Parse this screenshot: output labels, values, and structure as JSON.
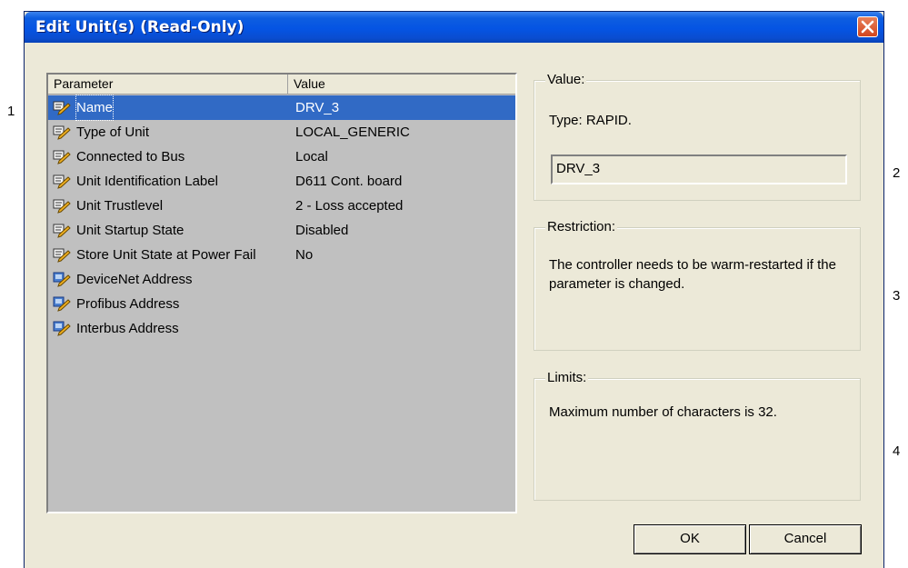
{
  "callouts": [
    "1",
    "2",
    "3",
    "4"
  ],
  "dialog": {
    "title": "Edit Unit(s) (Read-Only)"
  },
  "list": {
    "columns": [
      "Parameter",
      "Value"
    ],
    "rows": [
      {
        "icon": "edit-parameter-icon",
        "parameter": "Name",
        "value": "DRV_3",
        "selected": true
      },
      {
        "icon": "edit-parameter-icon",
        "parameter": "Type of Unit",
        "value": "LOCAL_GENERIC"
      },
      {
        "icon": "edit-parameter-icon",
        "parameter": "Connected to Bus",
        "value": "Local"
      },
      {
        "icon": "edit-parameter-icon",
        "parameter": "Unit Identification Label",
        "value": "D611 Cont. board"
      },
      {
        "icon": "edit-parameter-icon",
        "parameter": "Unit Trustlevel",
        "value": "2 - Loss accepted"
      },
      {
        "icon": "edit-parameter-icon",
        "parameter": "Unit Startup State",
        "value": "Disabled"
      },
      {
        "icon": "edit-parameter-icon",
        "parameter": "Store Unit State at Power Fail",
        "value": "No"
      },
      {
        "icon": "disabled-parameter-icon",
        "parameter": "DeviceNet Address",
        "value": ""
      },
      {
        "icon": "disabled-parameter-icon",
        "parameter": "Profibus Address",
        "value": ""
      },
      {
        "icon": "disabled-parameter-icon",
        "parameter": "Interbus Address",
        "value": ""
      }
    ]
  },
  "value_group": {
    "title": "Value:",
    "type_text": "Type: RAPID.",
    "field_value": "DRV_3"
  },
  "restriction_group": {
    "title": "Restriction:",
    "text": "The controller needs to be warm-restarted if the parameter is changed."
  },
  "limits_group": {
    "title": "Limits:",
    "text": "Maximum number of characters is 32."
  },
  "buttons": {
    "ok": "OK",
    "cancel": "Cancel"
  },
  "colors": {
    "titlebar": "#0554e3",
    "selection": "#316ac5",
    "dialog_bg": "#ece9d8",
    "list_bg": "#c0c0c0"
  }
}
